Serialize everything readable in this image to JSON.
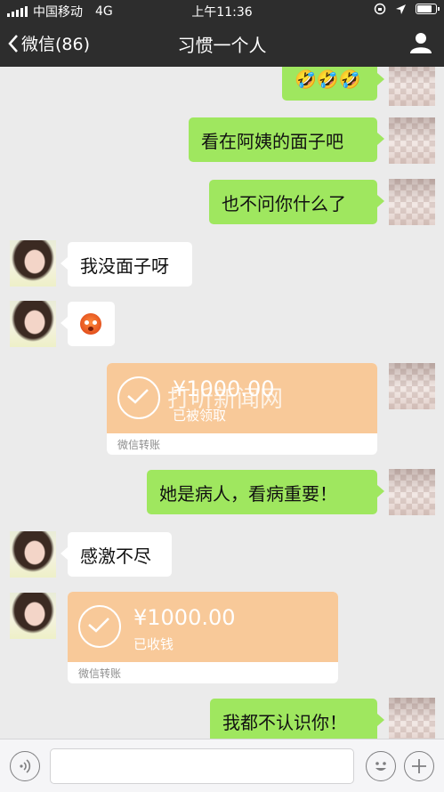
{
  "status_bar": {
    "carrier": "中国移动",
    "network": "4G",
    "time": "上午11:36"
  },
  "nav": {
    "back_label": "微信(86)",
    "title": "习惯一个人"
  },
  "messages": {
    "m1_emoji": "🤣🤣🤣",
    "m2": "看在阿姨的面子吧",
    "m3": "也不问你什么了",
    "m4": "我没面子呀",
    "m5_emoji": "angry-face",
    "transfer1": {
      "amount": "¥1000.00",
      "status": "已被领取",
      "label": "微信转账",
      "watermark": "打听新闻网"
    },
    "m7": "她是病人，看病重要！",
    "m8": "感激不尽",
    "transfer2": {
      "amount": "¥1000.00",
      "status": "已收钱",
      "label": "微信转账"
    },
    "m10": "我都不认识你！"
  },
  "input_bar": {
    "value": "",
    "voice_icon": "voice-icon",
    "emoji_icon": "emoji-icon",
    "add_icon": "plus-icon"
  },
  "colors": {
    "header": "#2d2d2d",
    "my_bubble": "#9fe75f",
    "transfer": "#f8c999",
    "background": "#ebebeb"
  }
}
